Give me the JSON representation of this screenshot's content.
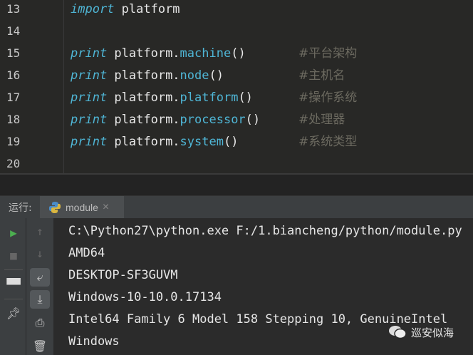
{
  "editor": {
    "lines": [
      {
        "num": "13",
        "kw": "import",
        "rest": " platform",
        "fn": "",
        "paren": "",
        "comment": ""
      },
      {
        "num": "14",
        "kw": "",
        "rest": "",
        "fn": "",
        "paren": "",
        "comment": ""
      },
      {
        "num": "15",
        "kw": "print",
        "rest": " platform.",
        "fn": "machine",
        "paren": "()",
        "comment": "#平台架构"
      },
      {
        "num": "16",
        "kw": "print",
        "rest": " platform.",
        "fn": "node",
        "paren": "()",
        "comment": "#主机名"
      },
      {
        "num": "17",
        "kw": "print",
        "rest": " platform.",
        "fn": "platform",
        "paren": "()",
        "comment": "#操作系统"
      },
      {
        "num": "18",
        "kw": "print",
        "rest": " platform.",
        "fn": "processor",
        "paren": "()",
        "comment": "#处理器"
      },
      {
        "num": "19",
        "kw": "print",
        "rest": " platform.",
        "fn": "system",
        "paren": "()",
        "comment": "#系统类型"
      },
      {
        "num": "20",
        "kw": "",
        "rest": "",
        "fn": "",
        "paren": "",
        "comment": ""
      }
    ]
  },
  "run": {
    "label": "运行:",
    "tab": "module",
    "close": "×"
  },
  "console": {
    "lines": [
      "C:\\Python27\\python.exe F:/1.biancheng/python/module.py",
      "AMD64",
      "DESKTOP-SF3GUVM",
      "Windows-10-10.0.17134",
      "Intel64 Family 6 Model 158 Stepping 10, GenuineIntel",
      "Windows"
    ]
  },
  "watermark": "巡安似海"
}
